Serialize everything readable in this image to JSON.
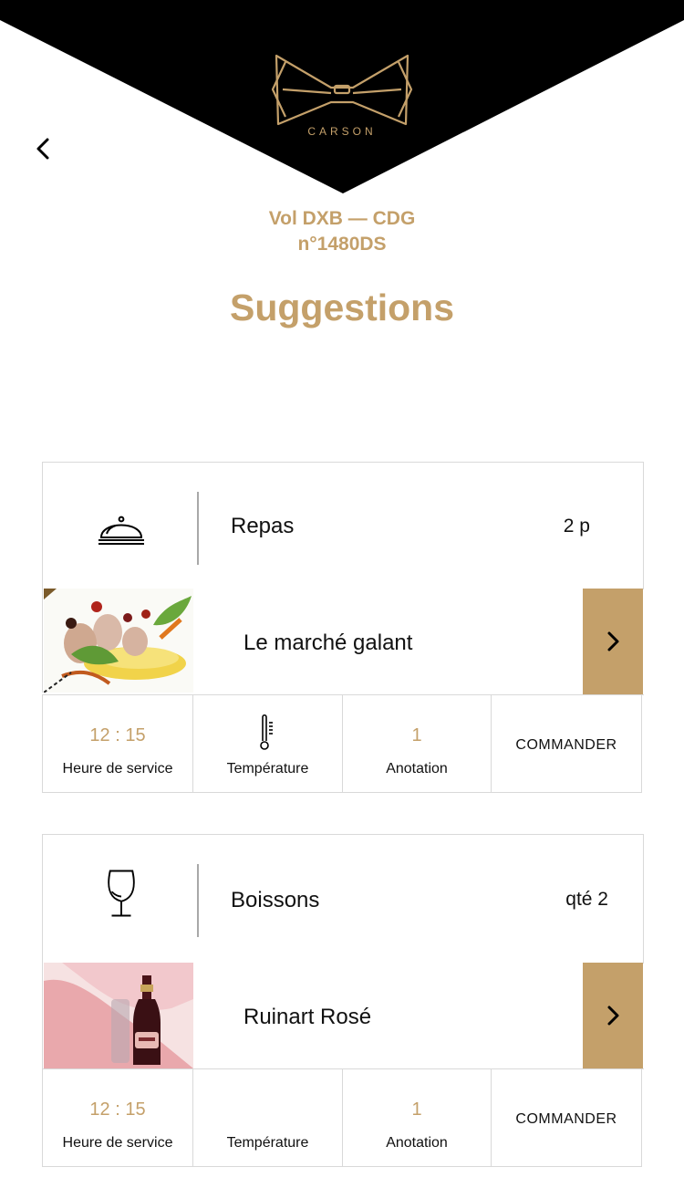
{
  "header": {
    "brand": "CARSON",
    "flight_route": "Vol DXB — CDG",
    "flight_number": "n°1480DS",
    "title": "Suggestions",
    "back_icon": "chevron-left-icon"
  },
  "colors": {
    "accent": "#c4a06a",
    "header_bg": "#000000",
    "border": "#d9d9d9"
  },
  "cards": [
    {
      "category": "Repas",
      "count": "2 p",
      "icon": "cloche-icon",
      "item_name": "Le marché galant",
      "service_time": "12 : 15",
      "service_time_label": "Heure de service",
      "temperature_label": "Température",
      "annotation_count": "1",
      "annotation_label": "Anotation",
      "order_label": "COMMANDER"
    },
    {
      "category": "Boissons",
      "count": "qté 2",
      "icon": "wine-glass-icon",
      "item_name": "Ruinart Rosé",
      "service_time": "12 : 15",
      "service_time_label": "Heure de service",
      "temperature_label": "Température",
      "annotation_count": "1",
      "annotation_label": "Anotation",
      "order_label": "COMMANDER"
    }
  ]
}
